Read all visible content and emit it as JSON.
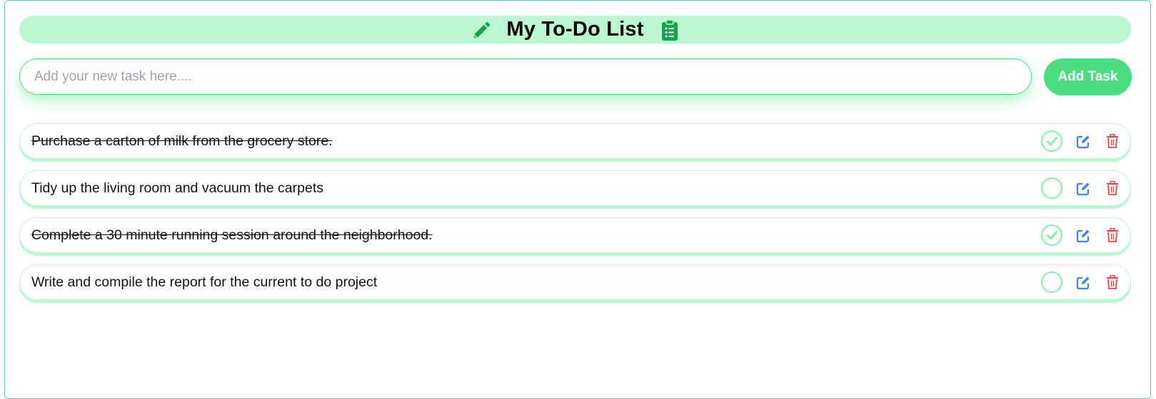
{
  "header": {
    "title": "My To-Do List",
    "left_icon": "pencil-icon",
    "right_icon": "clipboard-list-icon"
  },
  "new_task": {
    "placeholder": "Add your new task here....",
    "value": "",
    "button_label": "Add Task"
  },
  "tasks": [
    {
      "text": "Purchase a carton of milk from the grocery store.",
      "completed": true
    },
    {
      "text": "Tidy up the living room and vacuum the carpets",
      "completed": false
    },
    {
      "text": "Complete a 30 minute running session around the neighborhood.",
      "completed": true
    },
    {
      "text": "Write and compile the report for the current to do project",
      "completed": false
    }
  ],
  "icons": {
    "check": "check-circle-icon",
    "edit": "edit-icon",
    "delete": "trash-icon"
  },
  "colors": {
    "accent": "#4ade80",
    "accent_light": "#bbf7d0",
    "title_icon": "#16a34a",
    "edit_icon": "#3b82f6",
    "delete_icon": "#ef4444"
  }
}
